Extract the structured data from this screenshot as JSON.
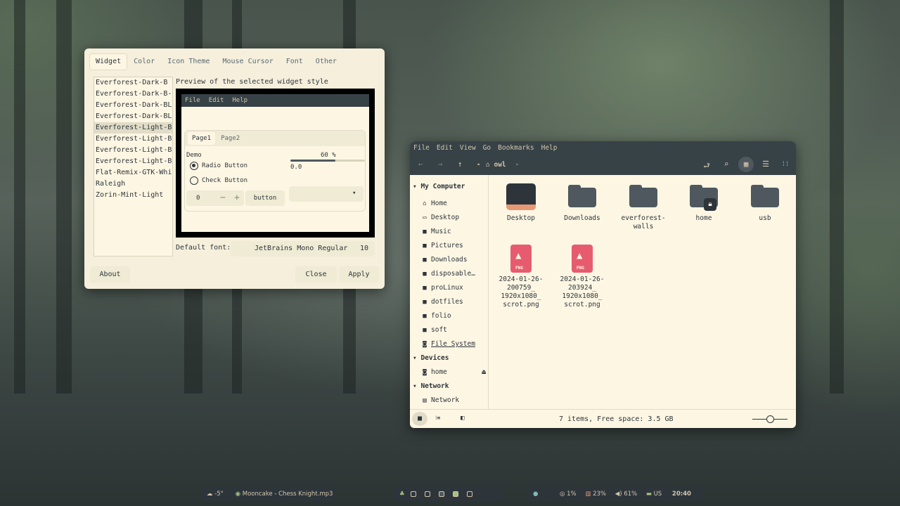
{
  "lxappearance": {
    "tabs": [
      "Widget",
      "Color",
      "Icon Theme",
      "Mouse Cursor",
      "Font",
      "Other"
    ],
    "themes": [
      "Everforest-Dark-B",
      "Everforest-Dark-B-LB",
      "Everforest-Dark-BL",
      "Everforest-Dark-BL-LB",
      "Everforest-Light-B",
      "Everforest-Light-B-LB",
      "Everforest-Light-BL",
      "Everforest-Light-BL-LB",
      "Flat-Remix-GTK-White-Darkest",
      "Raleigh",
      "Zorin-Mint-Light"
    ],
    "selected_theme": "Everforest-Light-B",
    "preview_label": "Preview of the selected widget style",
    "preview": {
      "menu": [
        "File",
        "Edit",
        "Help"
      ],
      "tabs": [
        "Page1",
        "Page2"
      ],
      "demo": "Demo",
      "radio": "Radio Button",
      "check": "Check Button",
      "progress_text": "60 %",
      "progress": 0.6,
      "scale_value": "0.0",
      "spin_value": "0",
      "button": "button"
    },
    "default_font_label": "Default font:",
    "font_name": "JetBrains Mono Regular",
    "font_size": "10",
    "about": "About",
    "close": "Close",
    "apply": "Apply"
  },
  "filemanager": {
    "menu": [
      "File",
      "Edit",
      "View",
      "Go",
      "Bookmarks",
      "Help"
    ],
    "location": "owl",
    "sections": {
      "my_computer": "My Computer",
      "devices": "Devices",
      "network": "Network"
    },
    "places": [
      "Home",
      "Desktop",
      "Music",
      "Pictures",
      "Downloads",
      "disposable…",
      "proLinux",
      "dotfiles",
      "folio",
      "soft",
      "File System"
    ],
    "devices": [
      "home"
    ],
    "network": [
      "Network"
    ],
    "files": [
      {
        "name": "Desktop"
      },
      {
        "name": "Downloads"
      },
      {
        "name": "everforest-\nwalls"
      },
      {
        "name": "home"
      },
      {
        "name": "usb"
      }
    ],
    "images": [
      {
        "name": "2024-01-26-\n200759_\n1920x1080_\nscrot.png",
        "ext": "PNG"
      },
      {
        "name": "2024-01-26-\n203924_\n1920x1080_\nscrot.png",
        "ext": "PNG"
      }
    ],
    "status": "7 items, Free space: 3.5 GB"
  },
  "taskbar": {
    "weather": "-5°",
    "media": "Mooncake - Chess Knight.mp3",
    "cpu": "1%",
    "mem": "23%",
    "volume": "61%",
    "keyboard": "US",
    "time": "20:40"
  },
  "colors": {
    "accent": "#e69875",
    "bg": "#fdf6e3",
    "dark": "#374247",
    "png": "#e65c6e"
  }
}
